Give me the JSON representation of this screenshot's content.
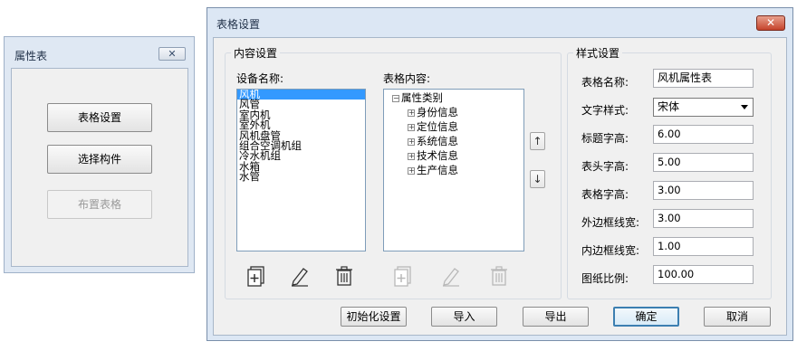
{
  "props_window": {
    "title": "属性表",
    "close_glyph": "✕",
    "buttons": [
      {
        "label": "表格设置",
        "enabled": true
      },
      {
        "label": "选择构件",
        "enabled": true
      },
      {
        "label": "布置表格",
        "enabled": false
      }
    ]
  },
  "dialog": {
    "title": "表格设置",
    "close_glyph": "✕",
    "content_group": {
      "legend": "内容设置",
      "device_label": "设备名称:",
      "device_items": [
        "风机",
        "风管",
        "室内机",
        "室外机",
        "风机盘管",
        "组合空调机组",
        "冷水机组",
        "水箱",
        "水管"
      ],
      "selected_device": "风机",
      "table_content_label": "表格内容:",
      "tree_root": "属性类别",
      "tree_children": [
        "身份信息",
        "定位信息",
        "系统信息",
        "技术信息",
        "生产信息"
      ],
      "up_arrow": "↑",
      "down_arrow": "↓"
    },
    "style_group": {
      "legend": "样式设置",
      "fields": [
        {
          "label": "表格名称:",
          "value": "风机属性表"
        },
        {
          "label": "文字样式:",
          "value": "宋体"
        },
        {
          "label": "标题字高:",
          "value": "6.00"
        },
        {
          "label": "表头字高:",
          "value": "5.00"
        },
        {
          "label": "表格字高:",
          "value": "3.00"
        },
        {
          "label": "外边框线宽:",
          "value": "3.00"
        },
        {
          "label": "内边框线宽:",
          "value": "1.00"
        },
        {
          "label": "图纸比例:",
          "value": "100.00"
        }
      ]
    },
    "footer": {
      "init": "初始化设置",
      "import": "导入",
      "export": "导出",
      "ok": "确定",
      "cancel": "取消"
    }
  },
  "colors": {
    "selection": "#3399ff",
    "frame": "#dce7f4",
    "close_red": "#c5432b"
  }
}
